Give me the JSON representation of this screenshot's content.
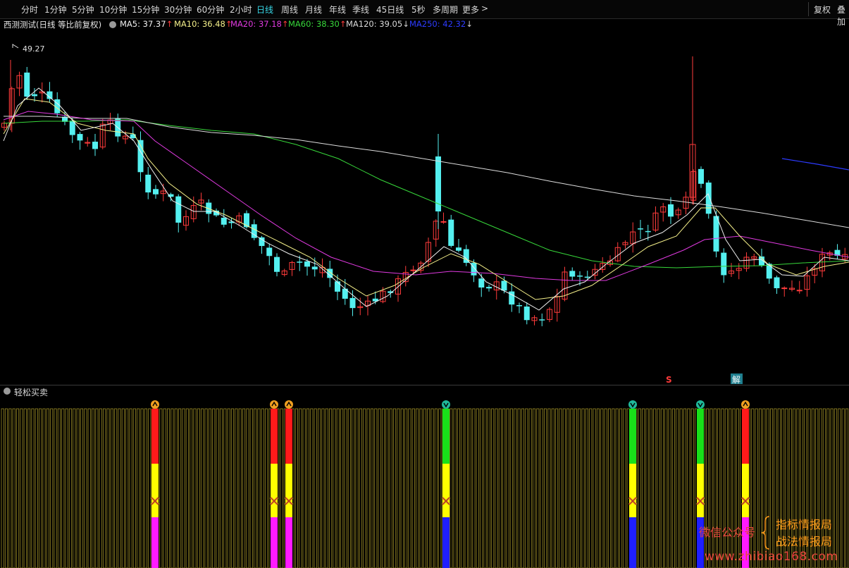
{
  "toolbar": {
    "tabs": [
      "分时",
      "1分钟",
      "5分钟",
      "10分钟",
      "15分钟",
      "30分钟",
      "60分钟",
      "2小时",
      "日线",
      "周线",
      "月线",
      "年线",
      "季线",
      "45日线",
      "5秒",
      "多周期",
      "更多"
    ],
    "active_tab": "日线",
    "more_arrow": ">",
    "right_buttons": [
      "复权",
      "叠加"
    ]
  },
  "info": {
    "title": "西测测试(日线 等比前复权)",
    "ma": [
      {
        "label": "MA5: 37.37",
        "arrow": "↑",
        "color": "#f0f0f0"
      },
      {
        "label": "MA10: 36.48",
        "arrow": "↑",
        "color": "#f5f08a"
      },
      {
        "label": "MA20: 37.18",
        "arrow": "↑",
        "color": "#e03ae0"
      },
      {
        "label": "MA60: 38.30",
        "arrow": "↑",
        "color": "#37d73a"
      },
      {
        "label": "MA120: 39.05",
        "arrow": "↓",
        "color": "#d9d9d9"
      },
      {
        "label": "MA250: 42.32",
        "arrow": "↓",
        "color": "#2d3bff"
      }
    ],
    "arrow_up_color": "#ff3b3b",
    "arrow_down_color": "#d0d0d0"
  },
  "main_chart": {
    "high_label": "49.27",
    "marker_s": "S",
    "marker_jie": "解",
    "up_color": "#ff3b3b",
    "down_color": "#54f0f0"
  },
  "sub_chart": {
    "title": "轻松买卖"
  },
  "watermark": {
    "line1": "微信公众号",
    "line2": "指标情报局",
    "line3": "战法情报局",
    "line4": "www.zhibiao168.com"
  }
}
